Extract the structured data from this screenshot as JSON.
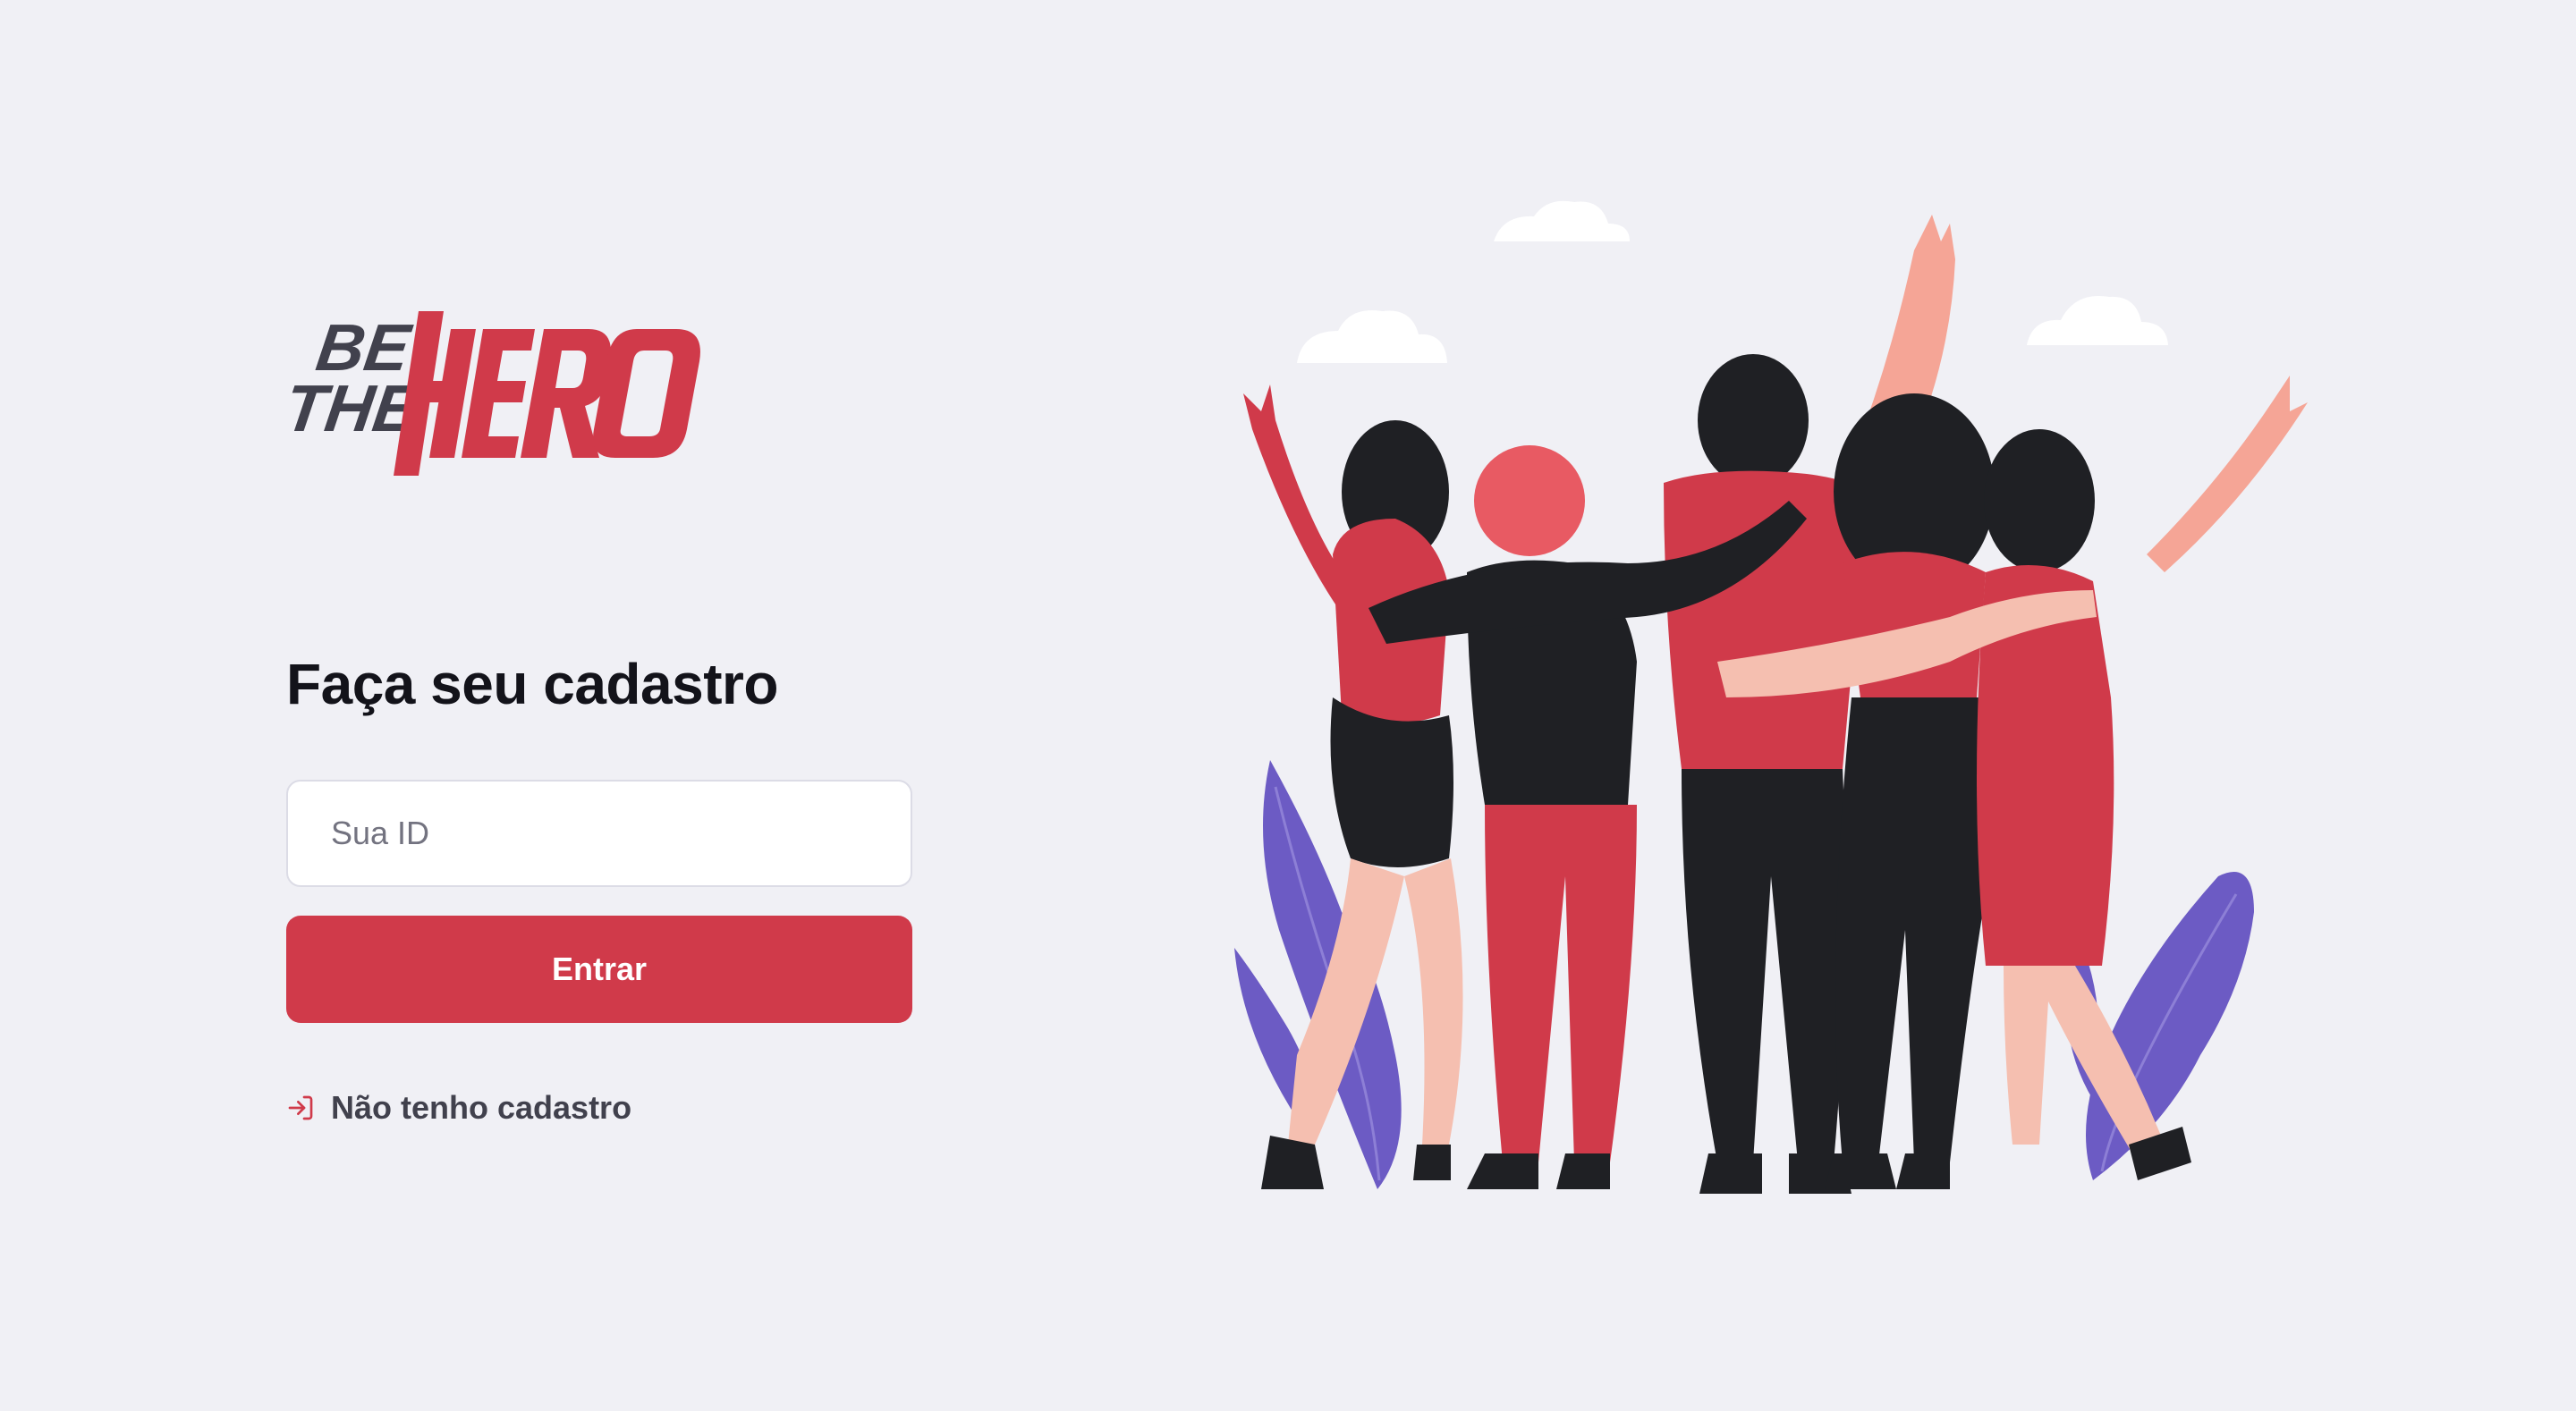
{
  "logo": {
    "line1": "BE",
    "line2": "THE",
    "word": "HERO"
  },
  "form": {
    "title": "Faça seu cadastro",
    "id_placeholder": "Sua ID",
    "id_value": "",
    "submit_label": "Entrar",
    "register_link_label": "Não tenho cadastro",
    "register_icon": "log-in-icon"
  },
  "colors": {
    "background": "#f0f0f5",
    "accent": "#d03a4a",
    "logo_dark": "#41414d",
    "text_dark": "#13131a"
  },
  "illustration": {
    "name": "heroes-group-illustration"
  }
}
